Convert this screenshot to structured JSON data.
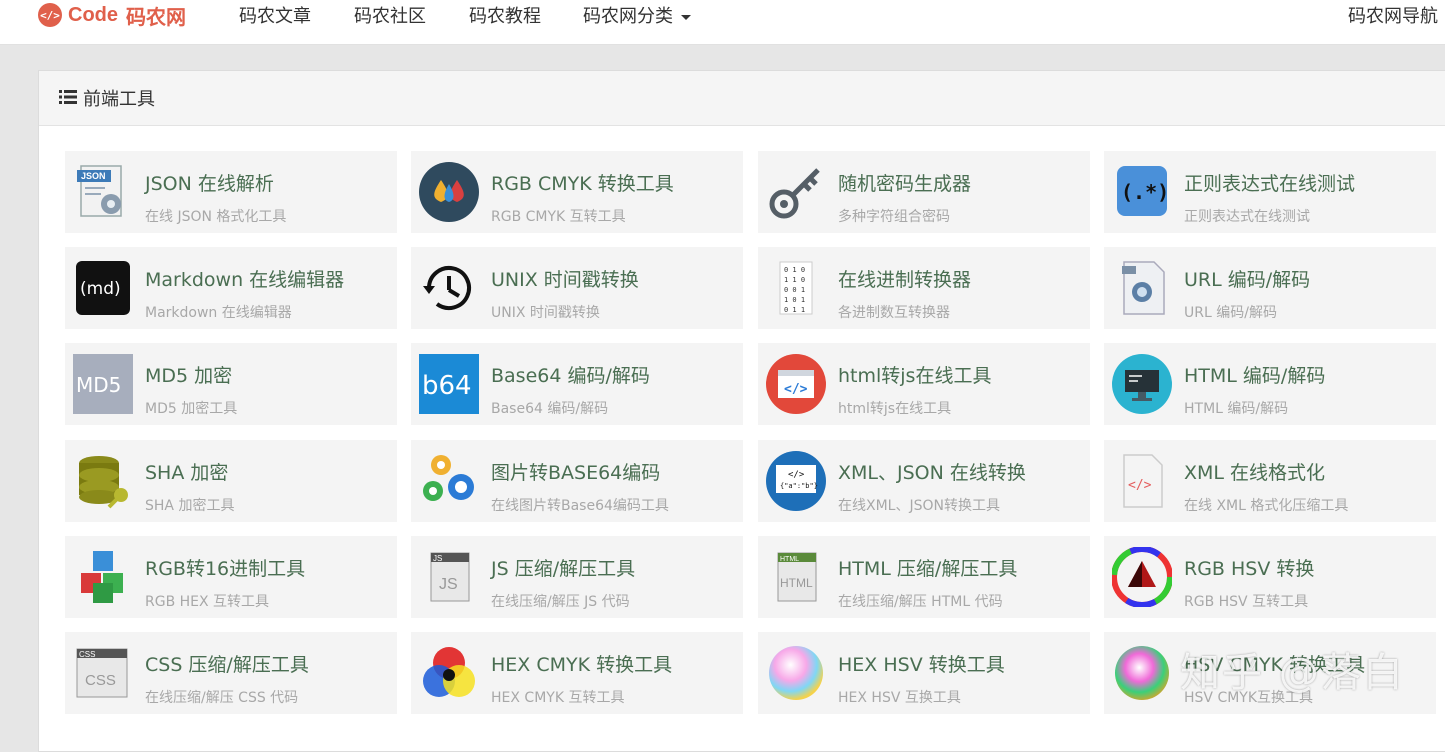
{
  "header": {
    "logo_code": "Code",
    "logo_cn": "码农网",
    "nav": [
      "码农文章",
      "码农社区",
      "码农教程",
      "码农网分类"
    ],
    "nav_right": "码农网导航"
  },
  "panel": {
    "title": "前端工具"
  },
  "tools": [
    {
      "title": "JSON 在线解析",
      "desc": "在线 JSON 格式化工具",
      "icon": "json-doc-icon"
    },
    {
      "title": "RGB CMYK 转换工具",
      "desc": "RGB CMYK 互转工具",
      "icon": "color-drops-icon"
    },
    {
      "title": "随机密码生成器",
      "desc": "多种字符组合密码",
      "icon": "key-icon"
    },
    {
      "title": "正则表达式在线测试",
      "desc": "正则表达式在线测试",
      "icon": "regex-icon"
    },
    {
      "title": "Markdown 在线编辑器",
      "desc": "Markdown 在线编辑器",
      "icon": "markdown-icon"
    },
    {
      "title": "UNIX 时间戳转换",
      "desc": "UNIX 时间戳转换",
      "icon": "clock-history-icon"
    },
    {
      "title": "在线进制转换器",
      "desc": "各进制数互转换器",
      "icon": "binary-icon"
    },
    {
      "title": "URL 编码/解码",
      "desc": "URL 编码/解码",
      "icon": "url-doc-icon"
    },
    {
      "title": "MD5 加密",
      "desc": "MD5 加密工具",
      "icon": "md5-icon"
    },
    {
      "title": "Base64 编码/解码",
      "desc": "Base64 编码/解码",
      "icon": "b64-icon"
    },
    {
      "title": "html转js在线工具",
      "desc": "html转js在线工具",
      "icon": "code-window-icon"
    },
    {
      "title": "HTML 编码/解码",
      "desc": "HTML 编码/解码",
      "icon": "monitor-icon"
    },
    {
      "title": "SHA 加密",
      "desc": "SHA 加密工具",
      "icon": "database-key-icon"
    },
    {
      "title": "图片转BASE64编码",
      "desc": "在线图片转Base64编码工具",
      "icon": "gears-icon"
    },
    {
      "title": "XML、JSON 在线转换",
      "desc": "在线XML、JSON转换工具",
      "icon": "xml-json-icon"
    },
    {
      "title": "XML 在线格式化",
      "desc": "在线 XML 格式化压缩工具",
      "icon": "xml-doc-icon"
    },
    {
      "title": "RGB转16进制工具",
      "desc": "RGB HEX 互转工具",
      "icon": "cubes-icon"
    },
    {
      "title": "JS 压缩/解压工具",
      "desc": "在线压缩/解压 JS 代码",
      "icon": "js-doc-icon"
    },
    {
      "title": "HTML 压缩/解压工具",
      "desc": "在线压缩/解压 HTML 代码",
      "icon": "html-doc-icon"
    },
    {
      "title": "RGB HSV 转换",
      "desc": "RGB HSV 互转工具",
      "icon": "color-wheel-icon"
    },
    {
      "title": "CSS 压缩/解压工具",
      "desc": "在线压缩/解压 CSS 代码",
      "icon": "css-doc-icon"
    },
    {
      "title": "HEX CMYK 转换工具",
      "desc": "HEX CMYK 互转工具",
      "icon": "cmyk-circles-icon"
    },
    {
      "title": "HEX HSV 转换工具",
      "desc": "HEX HSV 互换工具",
      "icon": "color-ball-icon"
    },
    {
      "title": "HSV CMYK 转换工具",
      "desc": "HSV CMYK互换工具",
      "icon": "color-sphere-icon"
    }
  ],
  "watermark": "知乎 @落白"
}
